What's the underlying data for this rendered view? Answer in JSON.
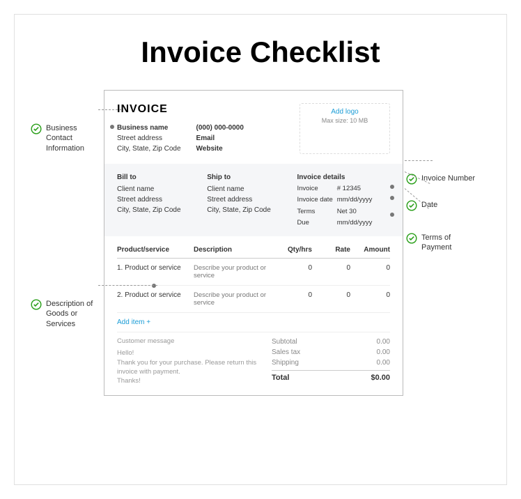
{
  "title": "Invoice Checklist",
  "callouts": {
    "bizContact": "Business Contact Information",
    "descGoods": "Description of Goods or Services",
    "invNumber": "Invoice Number",
    "date": "Date",
    "terms": "Terms of Payment"
  },
  "invoice": {
    "heading": "INVOICE",
    "biz": {
      "name": "Business name",
      "street": "Street address",
      "city": "City, State, Zip Code",
      "phone": "(000) 000-0000",
      "email": "Email",
      "website": "Website"
    },
    "logo": {
      "add": "Add logo",
      "max": "Max size: 10 MB"
    },
    "billTo": {
      "head": "Bill to",
      "name": "Client name",
      "street": "Street address",
      "city": "City, State, Zip Code"
    },
    "shipTo": {
      "head": "Ship to",
      "name": "Client name",
      "street": "Street address",
      "city": "City, State, Zip Code"
    },
    "details": {
      "head": "Invoice details",
      "invLabel": "Invoice",
      "invVal": "# 12345",
      "dateLabel": "Invoice date",
      "dateVal": "mm/dd/yyyy",
      "termsLabel": "Terms",
      "termsVal": "Net 30",
      "dueLabel": "Due",
      "dueVal": "mm/dd/yyyy"
    },
    "columns": {
      "prod": "Product/service",
      "desc": "Description",
      "qty": "Qty/hrs",
      "rate": "Rate",
      "amt": "Amount"
    },
    "lines": [
      {
        "num": "1.",
        "prod": "Product or service",
        "desc": "Describe your product or service",
        "qty": "0",
        "rate": "0",
        "amt": "0"
      },
      {
        "num": "2.",
        "prod": "Product or service",
        "desc": "Describe your product or service",
        "qty": "0",
        "rate": "0",
        "amt": "0"
      }
    ],
    "addItem": "Add item +",
    "message": {
      "head": "Customer message",
      "body": "Hello!\nThank you for your purchase. Please return this invoice with payment.\nThanks!"
    },
    "totals": {
      "subtotalLabel": "Subtotal",
      "subtotalVal": "0.00",
      "taxLabel": "Sales tax",
      "taxVal": "0.00",
      "shipLabel": "Shipping",
      "shipVal": "0.00",
      "totalLabel": "Total",
      "totalVal": "$0.00"
    }
  }
}
